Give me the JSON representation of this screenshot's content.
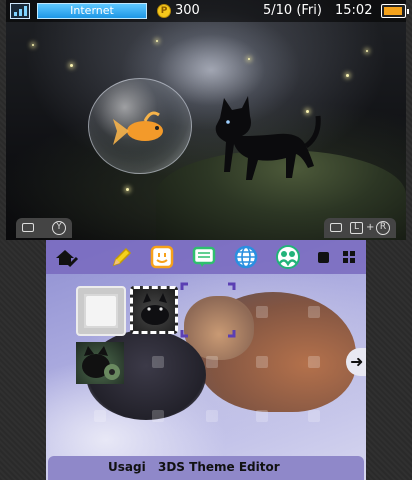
{
  "status_bar": {
    "connection_label": "Internet",
    "coin_count": "300",
    "date": "5/10 (Fri)",
    "time": "15:02",
    "battery_color": "#f4a21c",
    "connection_color": "#1e97e6"
  },
  "controls": {
    "top_left_button": "Y",
    "top_right_buttons": [
      "L",
      "R"
    ]
  },
  "top_screen": {
    "wallpaper_subject": "black cat looking at goldfish in bubble"
  },
  "bottom_screen": {
    "toolbar_icons": [
      "home-settings-icon",
      "pencil-icon",
      "smiley-icon",
      "message-icon",
      "globe-icon",
      "friends-icon",
      "small-square-icon",
      "grid-icon"
    ],
    "icon_colors": {
      "pencil": "#f4d21c",
      "smiley": "#f7a11a",
      "message": "#2fbf6f",
      "globe": "#2a8fe0",
      "friends": "#22b37a"
    },
    "footer": {
      "creator": "Usagi",
      "editor": "3DS Theme Editor"
    }
  }
}
